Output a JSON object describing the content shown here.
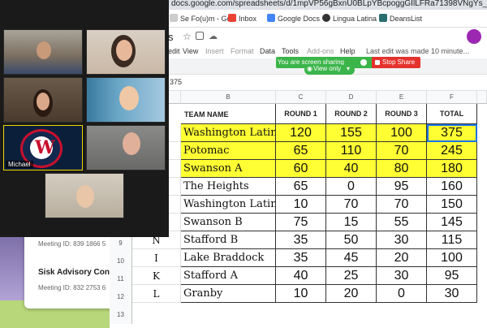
{
  "desktop": {
    "meeting_card": {
      "meeting_id_1": "Meeting ID: 839 1866 5",
      "title_2": "Sisk Advisory Con",
      "meeting_id_2": "Meeting ID: 832 2753 6"
    }
  },
  "browser": {
    "url": "docs.google.com/spreadsheets/d/1mpVP56gBxnU0BLpYBcpoggGIlLFRa71398VNgYs_7pc/edit",
    "bookmarks": [
      "Se Fo(u)m - Go...",
      "Inbox",
      "Google Docs",
      "Lingua Latina",
      "DeansList"
    ],
    "menu": [
      "edit",
      "View",
      "Insert",
      "Format",
      "Data",
      "Tools",
      "Add-ons",
      "Help"
    ],
    "last_edit": "Last edit was made 10 minute...",
    "doc_title_fragment": "s",
    "formula_value": "375"
  },
  "zoom": {
    "sharing_text": "You are screen sharing",
    "stop_share": "Stop Share",
    "view_only": "View only",
    "speaker_name": "Michael"
  },
  "sheet": {
    "columns": [
      "B",
      "C",
      "D",
      "E",
      "F"
    ],
    "headers": [
      "TEAM NAME",
      "ROUND 1",
      "ROUND 2",
      "ROUND 3",
      "TOTAL"
    ],
    "row_numbers": [
      "9",
      "10",
      "11",
      "12",
      "13"
    ],
    "rows": [
      {
        "rank": "",
        "team": "Washington Latin B",
        "r1": "120",
        "r2": "155",
        "r3": "100",
        "total": "375",
        "highlight": true
      },
      {
        "rank": "",
        "team": "Potomac",
        "r1": "65",
        "r2": "110",
        "r3": "70",
        "total": "245",
        "highlight": true
      },
      {
        "rank": "",
        "team": "Swanson A",
        "r1": "60",
        "r2": "40",
        "r3": "80",
        "total": "180",
        "highlight": true
      },
      {
        "rank": "",
        "team": "The Heights",
        "r1": "65",
        "r2": "0",
        "r3": "95",
        "total": "160",
        "highlight": false
      },
      {
        "rank": "",
        "team": "Washington Latin A",
        "r1": "10",
        "r2": "70",
        "r3": "70",
        "total": "150",
        "highlight": false
      },
      {
        "rank": "",
        "team": "Swanson B",
        "r1": "75",
        "r2": "15",
        "r3": "55",
        "total": "145",
        "highlight": false
      },
      {
        "rank": "N",
        "team": "Stafford B",
        "r1": "35",
        "r2": "50",
        "r3": "30",
        "total": "115",
        "highlight": false
      },
      {
        "rank": "I",
        "team": "Lake Braddock",
        "r1": "35",
        "r2": "45",
        "r3": "20",
        "total": "100",
        "highlight": false
      },
      {
        "rank": "K",
        "team": "Stafford A",
        "r1": "40",
        "r2": "25",
        "r3": "30",
        "total": "95",
        "highlight": false
      },
      {
        "rank": "L",
        "team": "Granby",
        "r1": "10",
        "r2": "20",
        "r3": "0",
        "total": "30",
        "highlight": false
      }
    ]
  },
  "colors": {
    "highlight": "#ffff33",
    "zoom_green": "#3bb54a",
    "stop_red": "#e5322d",
    "speaker_border": "#f2d600"
  }
}
